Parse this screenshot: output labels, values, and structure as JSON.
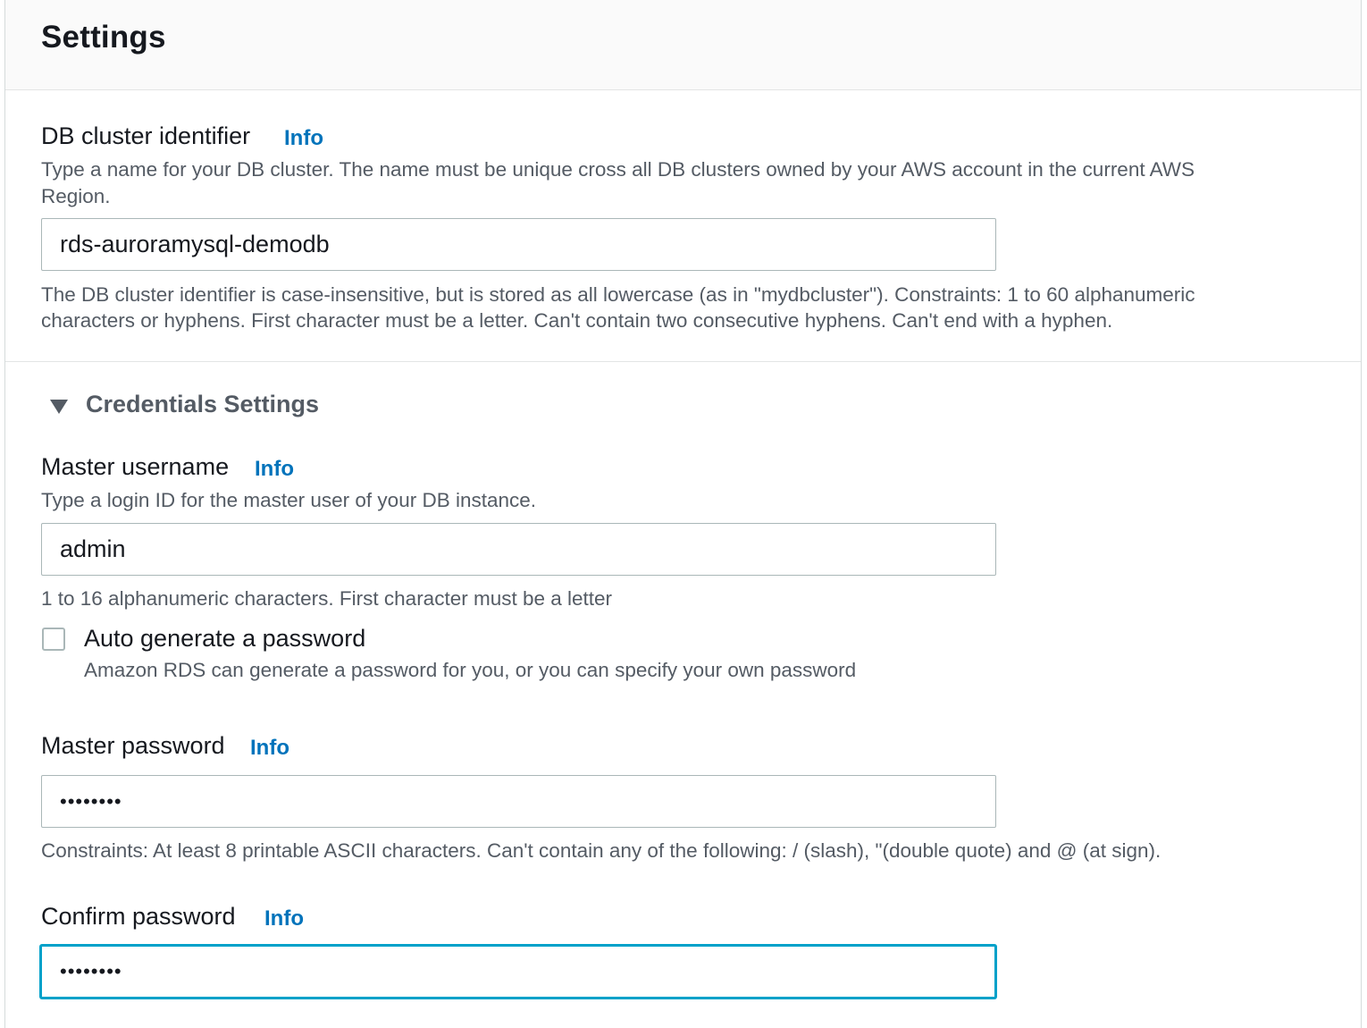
{
  "panel": {
    "title": "Settings"
  },
  "cluster": {
    "label": "DB cluster identifier",
    "info": "Info",
    "description_line1": "Type a name for your DB cluster. The name must be unique cross all DB clusters owned by your AWS account in the current AWS",
    "description_line2": "Region.",
    "value": "rds-auroramysql-demodb",
    "constraint_line1": "The DB cluster identifier is case-insensitive, but is stored as all lowercase (as in \"mydbcluster\"). Constraints: 1 to 60 alphanumeric",
    "constraint_line2": "characters or hyphens. First character must be a letter. Can't contain two consecutive hyphens. Can't end with a hyphen."
  },
  "credentials": {
    "title": "Credentials Settings",
    "expanded": true,
    "username": {
      "label": "Master username",
      "info": "Info",
      "description": "Type a login ID for the master user of your DB instance.",
      "value": "admin",
      "constraint": "1 to 16 alphanumeric characters. First character must be a letter"
    },
    "auto_generate": {
      "label": "Auto generate a password",
      "description": "Amazon RDS can generate a password for you, or you can specify your own password",
      "checked": false
    },
    "password": {
      "label": "Master password",
      "info": "Info",
      "value": "••••••••",
      "constraint": "Constraints: At least 8 printable ASCII characters. Can't contain any of the following: / (slash), \"(double quote) and @ (at sign)."
    },
    "confirm": {
      "label": "Confirm password",
      "info": "Info",
      "value": "••••••••",
      "focused": true
    }
  },
  "colors": {
    "link": "#0073bb",
    "focus": "#00a1c9",
    "muted_text": "#545b64",
    "border": "#aab7b8"
  }
}
